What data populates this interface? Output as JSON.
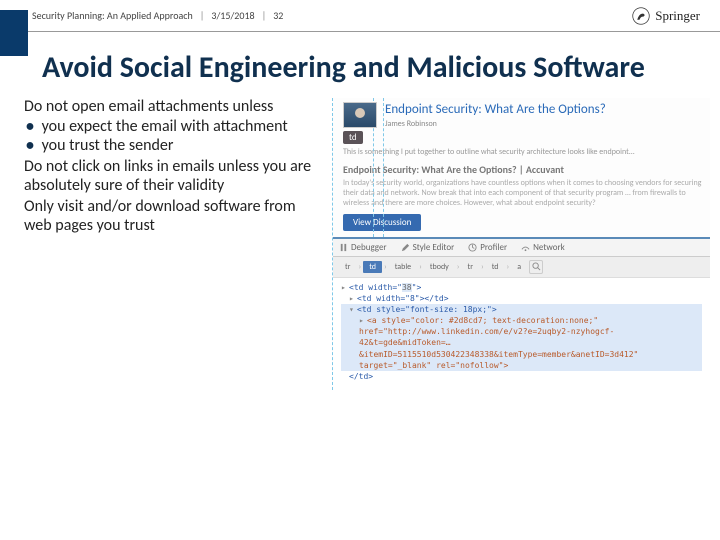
{
  "header": {
    "book": "Security Planning: An Applied Approach",
    "date": "3/15/2018",
    "page": "32",
    "publisher": "Springer"
  },
  "title": "Avoid Social Engineering and Malicious Software",
  "body": {
    "p1": "Do not open email attachments unless",
    "b1": "you expect the email with attachment",
    "b2": "you trust the sender",
    "p2": "Do not click on links in emails unless you are absolutely sure of their validity",
    "p3": "Only visit and/or download software from web pages you trust"
  },
  "article": {
    "title": "Endpoint Security: What Are the Options?",
    "author": "James Robinson",
    "tdlabel": "td",
    "sub": "This is something I put together to outline what security architecture looks like endpoint...",
    "h2": "Endpoint Security: What Are the Options? | Accuvant",
    "body": "In today's security world, organizations have countless options when it comes to choosing vendors for securing their data and network. Now break that into each component of that security program … from firewalls to wireless and there are more choices. However, what about endpoint security?",
    "button": "View Discussion"
  },
  "devtools": {
    "tabs": {
      "debugger": "Debugger",
      "style": "Style Editor",
      "profiler": "Profiler",
      "network": "Network"
    },
    "crumbs": [
      "tr",
      "td",
      "table",
      "tbody",
      "tr",
      "td",
      "a"
    ],
    "code": {
      "l1a": "<td width=\"",
      "l1b": "38",
      "l1c": "\">",
      "l2": "<td width=\"8\"></td>",
      "l3": "<td style=\"font-size: 18px;\">",
      "l4a": "<a style=\"color: #2d8cd7; text-decoration:none;\" href=\"http://www.linkedin.com/e/v2?e=2uqby2-nzyhogcf-42&t=gde&midToken=…&itemID=5115510d530422348338&itemType=member&anetID=3d412\" target=\"_blank\" rel=\"nofollow\">",
      "l5": "</td>"
    }
  }
}
